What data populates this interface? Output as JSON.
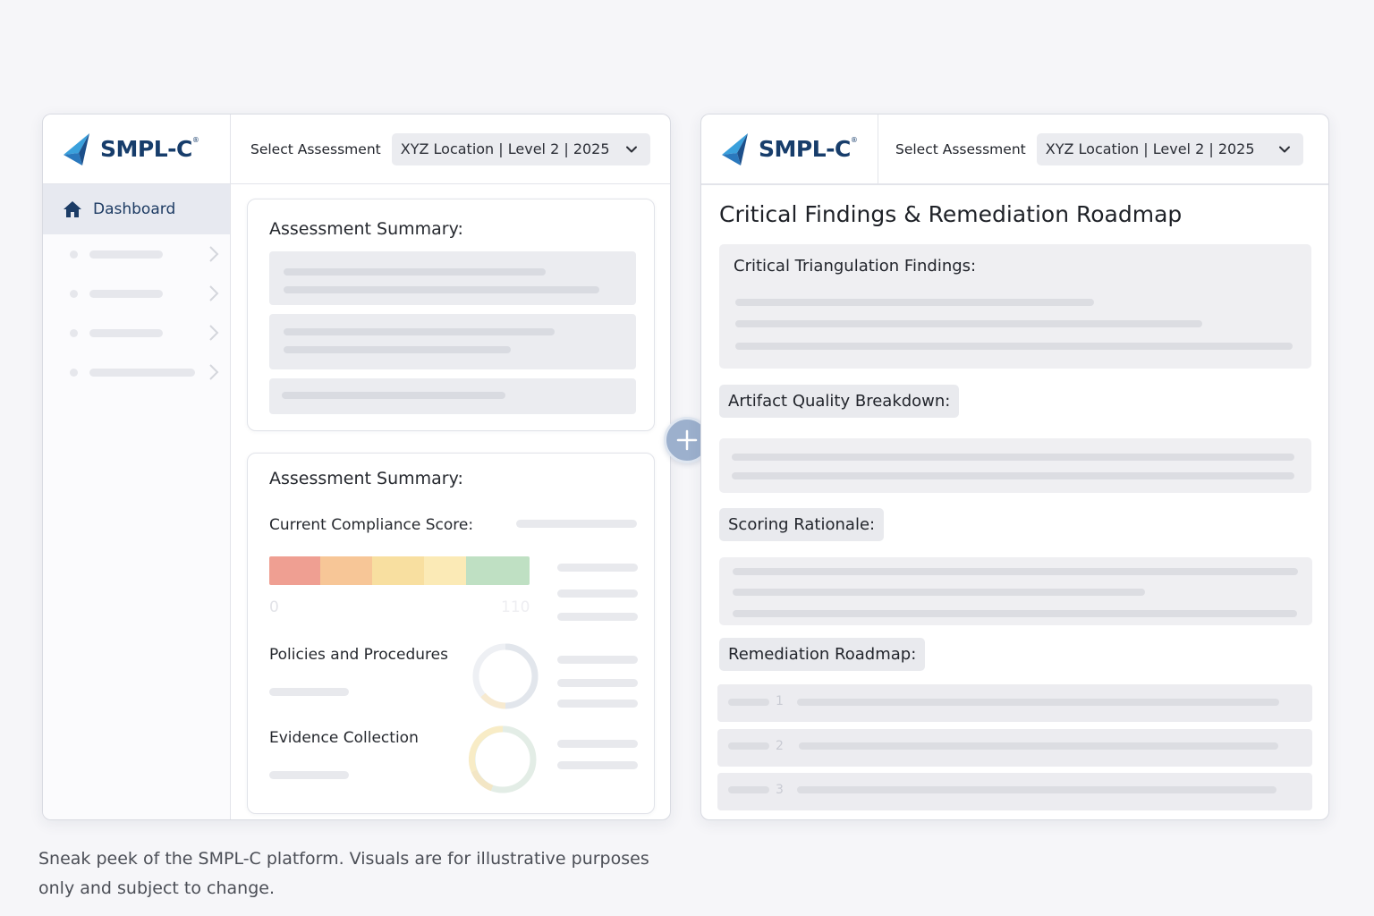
{
  "brand": {
    "name": "SMPL-C",
    "mark": "®"
  },
  "header": {
    "select_label": "Select Assessment",
    "select_value": "XYZ Location | Level 2 | 2025"
  },
  "sidebar": {
    "active_item": "Dashboard"
  },
  "left": {
    "summary_title": "Assessment Summary:",
    "summary2_title": "Assessment Summary:",
    "compliance_label": "Current Compliance Score:",
    "scale_min": "0",
    "scale_max": "110",
    "policies_label": "Policies and Procedures",
    "evidence_label": "Evidence Collection",
    "scale_colors": [
      "#ef9f92",
      "#f7c697",
      "#f8dfa0",
      "#fbeab6",
      "#bfe0c3"
    ]
  },
  "right": {
    "title": "Critical Findings & Remediation Roadmap",
    "critical_label": "Critical Triangulation Findings:",
    "artifact_label": "Artifact Quality Breakdown:",
    "scoring_label": "Scoring Rationale:",
    "roadmap_label": "Remediation Roadmap:",
    "roadmap_numbers": [
      "1",
      "2",
      "3"
    ]
  },
  "caption": "Sneak peek of the SMPL-C platform. Visuals are for illustrative purposes only and subject to change."
}
